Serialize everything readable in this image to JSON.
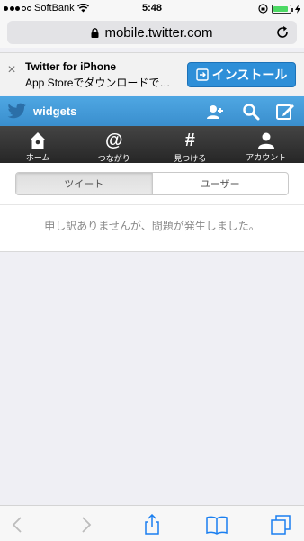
{
  "status_bar": {
    "carrier": "SoftBank",
    "time": "5:48",
    "battery_level": 0.9,
    "signal_bars": 3,
    "signal_total": 5
  },
  "url_bar": {
    "url": "mobile.twitter.com"
  },
  "app_banner": {
    "close_label": "×",
    "title": "Twitter for iPhone",
    "subtitle": "App Storeでダウンロードで…",
    "install_label": "インストール"
  },
  "twitter_header": {
    "title": "widgets",
    "brand_color": "#3a8fce"
  },
  "nav": {
    "items": [
      {
        "label": "ホーム",
        "icon": "home-icon"
      },
      {
        "label": "つながり",
        "icon": "at-icon",
        "glyph": "@"
      },
      {
        "label": "見つける",
        "icon": "hash-icon",
        "glyph": "#"
      },
      {
        "label": "アカウント",
        "icon": "person-icon"
      }
    ]
  },
  "tabs": {
    "items": [
      "ツイート",
      "ユーザー"
    ],
    "active_index": 0
  },
  "error": {
    "message": "申し訳ありませんが、問題が発生しました。"
  }
}
